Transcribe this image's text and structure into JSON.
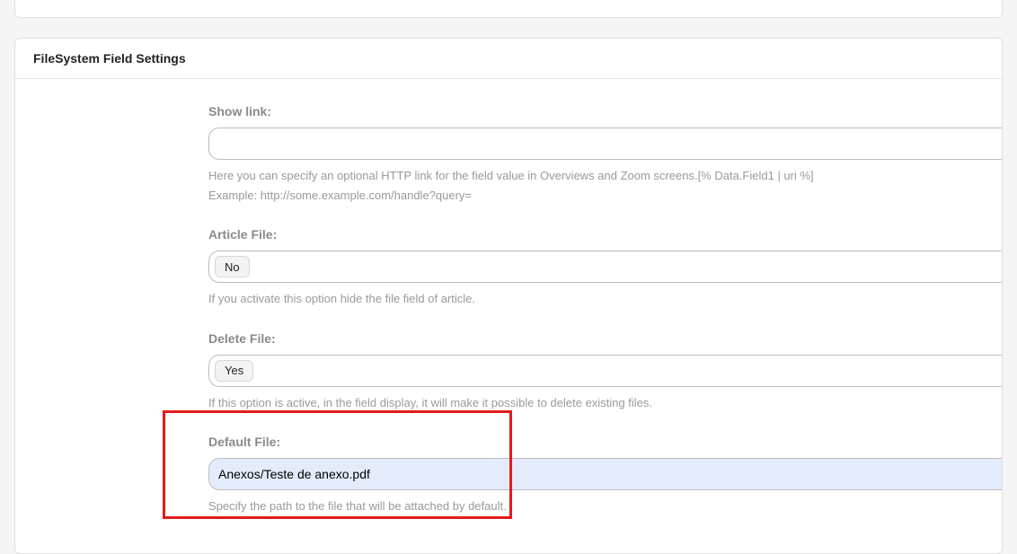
{
  "panel": {
    "title": "FileSystem Field Settings"
  },
  "fields": {
    "show_link": {
      "label": "Show link:",
      "value": "",
      "help_line1": "Here you can specify an optional HTTP link for the field value in Overviews and Zoom screens.[% Data.Field1 | uri %]",
      "help_line2": "Example: http://some.example.com/handle?query="
    },
    "article_file": {
      "label": "Article File:",
      "selected": "No",
      "help": "If you activate this option hide the file field of article."
    },
    "delete_file": {
      "label": "Delete File:",
      "selected": "Yes",
      "help": "If this option is active, in the field display, it will make it possible to delete existing files."
    },
    "default_file": {
      "label": "Default File:",
      "value": "Anexos/Teste de anexo.pdf",
      "help": "Specify the path to the file that will be attached by default."
    }
  }
}
